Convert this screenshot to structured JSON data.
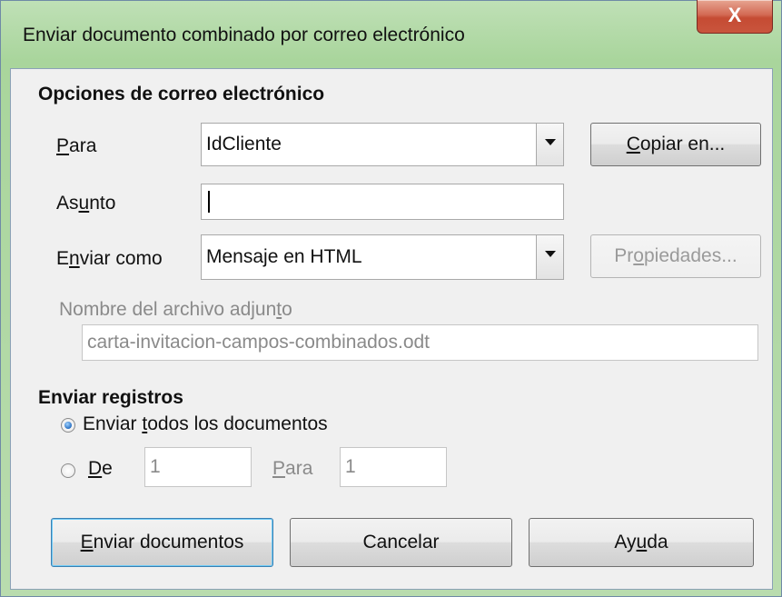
{
  "window": {
    "title": "Enviar documento combinado por correo electrónico",
    "close_glyph": "X"
  },
  "email_options": {
    "heading": "Opciones de correo electrónico",
    "to": {
      "label_mnemonic": "P",
      "label_rest": "ara",
      "value": "IdCliente",
      "copy_button": {
        "mnemonic": "C",
        "rest": "opiar en..."
      }
    },
    "subject": {
      "label_pre": "As",
      "label_mnemonic": "u",
      "label_rest": "nto",
      "value": ""
    },
    "send_as": {
      "label_pre": "E",
      "label_mnemonic": "n",
      "label_rest": "viar como",
      "value": "Mensaje en HTML",
      "properties_button": {
        "pre": "Pr",
        "mnemonic": "o",
        "rest": "piedades..."
      }
    },
    "attachment": {
      "label_pre": "Nombre del archivo adjun",
      "label_mnemonic": "t",
      "label_rest": "o",
      "value": "carta-invitacion-campos-combinados.odt"
    }
  },
  "send_records": {
    "heading": "Enviar registros",
    "all": {
      "pre": "Enviar ",
      "mnemonic": "t",
      "rest": "odos los documentos",
      "selected": true
    },
    "range": {
      "from_label": "De",
      "from_mnemonic": "D",
      "from_rest": "e",
      "from_value": "1",
      "to_mnemonic": "P",
      "to_rest": "ara",
      "to_value": "1",
      "selected": false
    }
  },
  "buttons": {
    "send": {
      "mnemonic": "E",
      "rest": "nviar documentos"
    },
    "cancel": "Cancelar",
    "help": {
      "pre": "Ay",
      "mnemonic": "u",
      "rest": "da"
    }
  }
}
